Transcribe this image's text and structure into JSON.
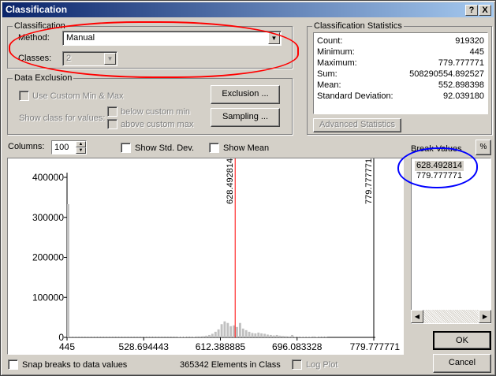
{
  "window": {
    "title": "Classification",
    "help_button": "?",
    "close_button": "X"
  },
  "classification": {
    "group_title": "Classification",
    "method_label": "Method:",
    "method_value": "Manual",
    "classes_label": "Classes:",
    "classes_value": "2"
  },
  "data_exclusion": {
    "group_title": "Data Exclusion",
    "use_custom_label": "Use Custom Min & Max",
    "show_class_label": "Show class for values:",
    "below_label": "below custom min",
    "above_label": "above custom max",
    "exclusion_button": "Exclusion ...",
    "sampling_button": "Sampling ..."
  },
  "statistics": {
    "group_title": "Classification Statistics",
    "rows": [
      {
        "label": "Count:",
        "value": "919320"
      },
      {
        "label": "Minimum:",
        "value": "445"
      },
      {
        "label": "Maximum:",
        "value": "779.777771"
      },
      {
        "label": "Sum:",
        "value": "508290554.892527"
      },
      {
        "label": "Mean:",
        "value": "552.898398"
      },
      {
        "label": "Standard Deviation:",
        "value": "92.039180"
      }
    ],
    "advanced_button": "Advanced Statistics"
  },
  "options": {
    "columns_label": "Columns:",
    "columns_value": "100",
    "show_std_dev_label": "Show Std. Dev.",
    "show_mean_label": "Show Mean",
    "percent_button": "%"
  },
  "break_values": {
    "title": "Break Values",
    "values": [
      "628.492814",
      "779.777771"
    ]
  },
  "footer": {
    "snap_label": "Snap breaks to data values",
    "elements_text": "365342 Elements in Class",
    "log_plot_label": "Log Plot",
    "ok_button": "OK",
    "cancel_button": "Cancel"
  },
  "colors": {
    "title_start": "#0a246a",
    "title_end": "#a6caf0",
    "annotation_red": "#ff0000",
    "annotation_blue": "#0000ff",
    "break_line": "#ff0000",
    "bars": "#c0c0c0"
  },
  "chart_data": {
    "type": "bar",
    "title": "",
    "xlabel": "",
    "ylabel": "",
    "xlim": [
      445,
      779.777771
    ],
    "ylim": [
      0,
      400000
    ],
    "y_ticks": [
      "400000",
      "300000",
      "200000",
      "100000",
      "0"
    ],
    "x_ticks": [
      "445",
      "528.694443",
      "612.388885",
      "696.083328",
      "779.777771"
    ],
    "break_lines": [
      "628.492814",
      "779.777771"
    ],
    "bins": [
      {
        "x": 445.0,
        "y": 333000
      },
      {
        "x": 448.3,
        "y": 600
      },
      {
        "x": 451.7,
        "y": 600
      },
      {
        "x": 455.0,
        "y": 600
      },
      {
        "x": 458.4,
        "y": 600
      },
      {
        "x": 461.7,
        "y": 600
      },
      {
        "x": 465.1,
        "y": 600
      },
      {
        "x": 468.4,
        "y": 600
      },
      {
        "x": 471.8,
        "y": 600
      },
      {
        "x": 475.1,
        "y": 600
      },
      {
        "x": 478.5,
        "y": 600
      },
      {
        "x": 481.8,
        "y": 600
      },
      {
        "x": 485.2,
        "y": 600
      },
      {
        "x": 488.5,
        "y": 600
      },
      {
        "x": 491.9,
        "y": 600
      },
      {
        "x": 495.2,
        "y": 600
      },
      {
        "x": 498.6,
        "y": 600
      },
      {
        "x": 501.9,
        "y": 600
      },
      {
        "x": 505.3,
        "y": 600
      },
      {
        "x": 508.6,
        "y": 600
      },
      {
        "x": 512.0,
        "y": 600
      },
      {
        "x": 515.3,
        "y": 600
      },
      {
        "x": 518.7,
        "y": 600
      },
      {
        "x": 522.0,
        "y": 600
      },
      {
        "x": 525.4,
        "y": 600
      },
      {
        "x": 528.7,
        "y": 600
      },
      {
        "x": 532.1,
        "y": 600
      },
      {
        "x": 535.4,
        "y": 600
      },
      {
        "x": 538.8,
        "y": 600
      },
      {
        "x": 542.1,
        "y": 600
      },
      {
        "x": 545.5,
        "y": 600
      },
      {
        "x": 548.8,
        "y": 600
      },
      {
        "x": 552.2,
        "y": 600
      },
      {
        "x": 555.5,
        "y": 600
      },
      {
        "x": 558.9,
        "y": 600
      },
      {
        "x": 562.2,
        "y": 600
      },
      {
        "x": 565.6,
        "y": 1200
      },
      {
        "x": 568.9,
        "y": 1200
      },
      {
        "x": 572.3,
        "y": 1200
      },
      {
        "x": 575.6,
        "y": 1800
      },
      {
        "x": 579.0,
        "y": 1800
      },
      {
        "x": 582.3,
        "y": 1200
      },
      {
        "x": 585.7,
        "y": 2400
      },
      {
        "x": 589.0,
        "y": 2400
      },
      {
        "x": 592.4,
        "y": 3000
      },
      {
        "x": 595.7,
        "y": 4200
      },
      {
        "x": 599.1,
        "y": 6000
      },
      {
        "x": 602.4,
        "y": 9000
      },
      {
        "x": 605.8,
        "y": 14000
      },
      {
        "x": 609.1,
        "y": 20000
      },
      {
        "x": 612.5,
        "y": 33000
      },
      {
        "x": 615.8,
        "y": 40000
      },
      {
        "x": 619.2,
        "y": 36000
      },
      {
        "x": 622.5,
        "y": 28000
      },
      {
        "x": 625.9,
        "y": 30000
      },
      {
        "x": 629.2,
        "y": 26000
      },
      {
        "x": 632.6,
        "y": 36000
      },
      {
        "x": 635.9,
        "y": 22000
      },
      {
        "x": 639.3,
        "y": 18000
      },
      {
        "x": 642.6,
        "y": 14000
      },
      {
        "x": 646.0,
        "y": 11000
      },
      {
        "x": 649.3,
        "y": 10000
      },
      {
        "x": 652.7,
        "y": 12000
      },
      {
        "x": 656.0,
        "y": 10000
      },
      {
        "x": 659.4,
        "y": 9000
      },
      {
        "x": 662.7,
        "y": 7000
      },
      {
        "x": 666.1,
        "y": 6000
      },
      {
        "x": 669.4,
        "y": 4800
      },
      {
        "x": 672.8,
        "y": 6000
      },
      {
        "x": 676.1,
        "y": 4200
      },
      {
        "x": 679.5,
        "y": 3600
      },
      {
        "x": 682.8,
        "y": 3000
      },
      {
        "x": 686.2,
        "y": 2400
      },
      {
        "x": 689.5,
        "y": 6000
      },
      {
        "x": 692.9,
        "y": 1800
      },
      {
        "x": 696.2,
        "y": 1800
      },
      {
        "x": 699.6,
        "y": 1200
      },
      {
        "x": 702.9,
        "y": 1200
      },
      {
        "x": 706.3,
        "y": 1200
      },
      {
        "x": 709.6,
        "y": 1200
      },
      {
        "x": 713.0,
        "y": 2400
      },
      {
        "x": 716.3,
        "y": 1200
      },
      {
        "x": 719.7,
        "y": 600
      },
      {
        "x": 723.0,
        "y": 600
      },
      {
        "x": 726.4,
        "y": 600
      }
    ]
  }
}
